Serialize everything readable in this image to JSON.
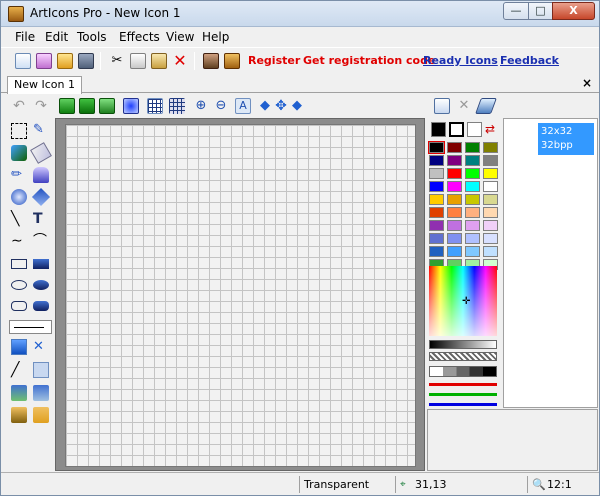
{
  "window": {
    "title": "ArtIcons Pro - New Icon 1",
    "min_glyph": "—",
    "max_glyph": "□",
    "close_glyph": "X"
  },
  "menu": [
    "File",
    "Edit",
    "Tools",
    "Effects",
    "View",
    "Help"
  ],
  "toolbar": {
    "links": {
      "register": "Register",
      "get_code": "Get registration code",
      "ready_icons": "Ready Icons",
      "feedback": "Feedback"
    },
    "colors": {
      "red": "#e00000",
      "blue": "#1a2fb0"
    }
  },
  "tabs": {
    "active": "New Icon 1",
    "close": "×"
  },
  "formats": {
    "size": "32x32",
    "depth": "32bpp"
  },
  "status": {
    "color_label": "Transparent",
    "coords": "31,13",
    "zoom": "12:1"
  },
  "palette": [
    [
      "#000000",
      "#800000",
      "#008000",
      "#808000"
    ],
    [
      "#000080",
      "#800080",
      "#008080",
      "#808080"
    ],
    [
      "#c0c0c0",
      "#ff0000",
      "#00ff00",
      "#ffff00"
    ],
    [
      "#0000ff",
      "#ff00ff",
      "#00ffff",
      "#ffffff"
    ],
    [
      "#ffcc00",
      "#e8a000",
      "#c8c800",
      "#d8d890"
    ],
    [
      "#e04000",
      "#ff8040",
      "#ffb080",
      "#ffd8b0"
    ],
    [
      "#9030b0",
      "#c070e0",
      "#e0a0f0",
      "#f0d0f8"
    ],
    [
      "#6070d0",
      "#8090f0",
      "#b0c0ff",
      "#d8e0ff"
    ],
    [
      "#2060c0",
      "#40a0ff",
      "#80c8ff",
      "#c0e0ff"
    ],
    [
      "#30a030",
      "#60d060",
      "#a0f0a0",
      "#d0ffd0"
    ]
  ]
}
